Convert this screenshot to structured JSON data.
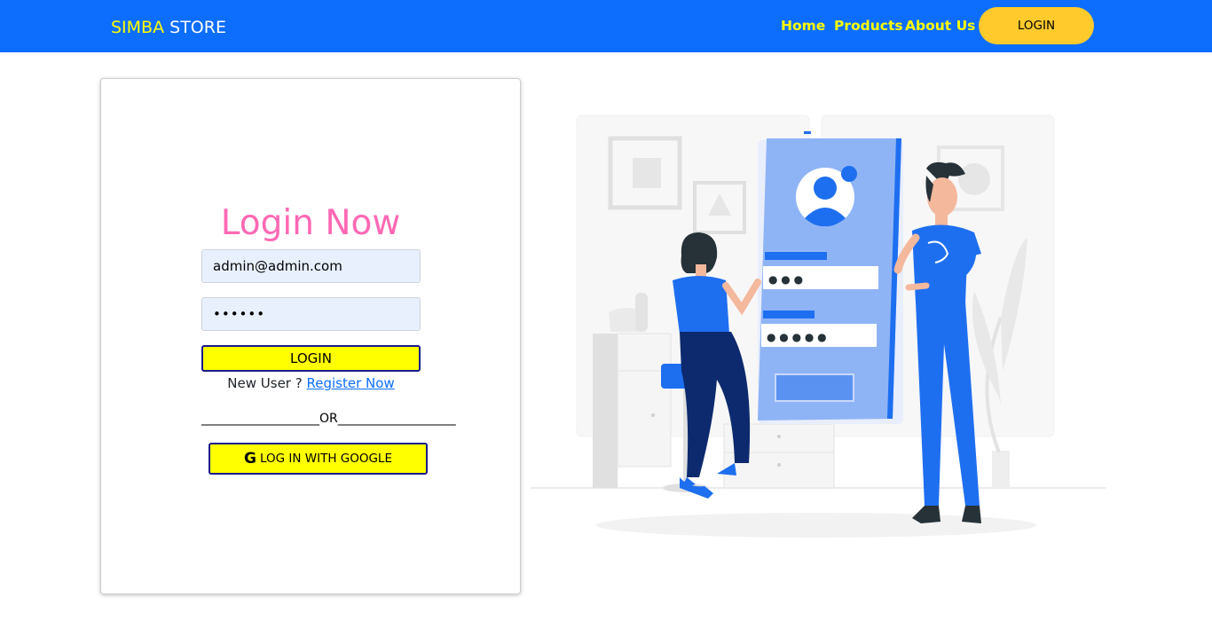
{
  "navbar": {
    "brand_accent": "SIMBA",
    "brand_rest": " STORE",
    "links": [
      "Home",
      "Products",
      "About Us"
    ],
    "login_button": "LOGIN"
  },
  "login_form": {
    "title": "Login Now",
    "email_value": "admin@admin.com",
    "password_value": "••••••",
    "login_button": "LOGIN",
    "new_user_text": "New User ? ",
    "register_link": "Register Now",
    "divider_text": "___________________OR___________________",
    "google_icon": "G",
    "google_button": "LOG IN WITH GOOGLE"
  },
  "illustration": {
    "description_icon": "login-illustration-icon",
    "field_dots_1": "● ● ●",
    "field_dots_2": "● ● ● ● ●"
  },
  "colors": {
    "navbar_bg": "#0d6efd",
    "brand_accent": "#ffff00",
    "nav_link": "#ffff00",
    "nav_login_bg": "#ffca2c",
    "title": "#ff69b4",
    "button_bg": "#ffff00",
    "button_border": "#1a1a8a",
    "input_bg": "#e8f0fe"
  }
}
